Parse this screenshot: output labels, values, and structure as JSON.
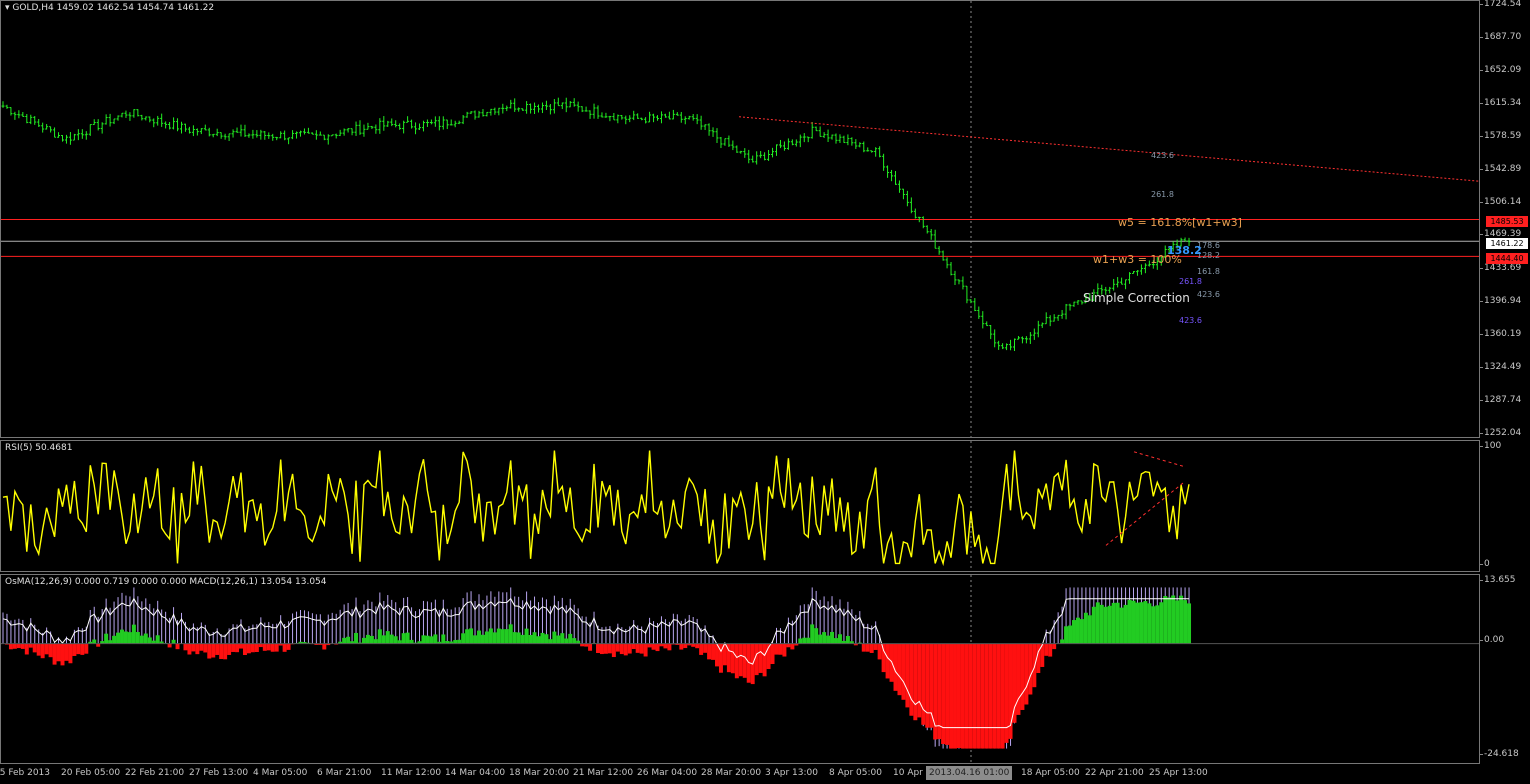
{
  "main_pane": {
    "title": "GOLD,H4  1459.02 1462.54 1454.74 1461.22",
    "price_axis": [
      "1724.54",
      "1687.70",
      "1652.09",
      "1615.34",
      "1578.59",
      "1542.89",
      "1506.14",
      "1469.39",
      "1433.69",
      "1396.94",
      "1360.19",
      "1324.49",
      "1287.74",
      "1252.04"
    ],
    "hlines": [
      {
        "price": 1485.53,
        "color": "#ff2020",
        "label": "1485.53"
      },
      {
        "price": 1461.22,
        "color": "#b0b0b0",
        "label": "1461.22"
      },
      {
        "price": 1444.4,
        "color": "#ff2020",
        "label": "1444.40"
      }
    ],
    "annotations": {
      "w5": "w5 = 161.8%[w1+w3]",
      "w1w3": "w1+w3 = 100%",
      "simple": "Simple Correction",
      "fib_423_top": "423.6",
      "fib_261_top": "261.8",
      "fib_261_low": "261.8",
      "fib_423_low": "423.6",
      "fib_423_bottom": "423.6",
      "fib_161": "161.8",
      "fib_178": "178.6",
      "fib_128": "128.2",
      "fib_1618": "161.8",
      "fib_1381": "138.2"
    }
  },
  "rsi_pane": {
    "title": "RSI(5) 50.4681",
    "scale": [
      "100",
      "0"
    ]
  },
  "osma_pane": {
    "title": "OsMA(12,26,9) 0.000 0.719 0.000 0.000  MACD(12,26,1) 13.054 13.054",
    "scale": [
      "13.655",
      "0.00",
      "-24.618"
    ]
  },
  "time_axis": {
    "labels": [
      "15 Feb 2013",
      "20 Feb 05:00",
      "22 Feb 21:00",
      "27 Feb 13:00",
      "4 Mar 05:00",
      "6 Mar 21:00",
      "11 Mar 12:00",
      "14 Mar 04:00",
      "18 Mar 20:00",
      "21 Mar 12:00",
      "26 Mar 04:00",
      "28 Mar 20:00",
      "3 Apr 13:00",
      "8 Apr 05:00",
      "10 Apr 2",
      "18 Apr 05:00",
      "22 Apr 21:00",
      "25 Apr 13:00"
    ],
    "crosshair": "2013.04.16 01:00"
  },
  "chart_data": {
    "type": "line",
    "symbol": "GOLD",
    "timeframe": "H4",
    "ylim": [
      1252.04,
      1724.54
    ],
    "close_approx": [
      {
        "t": "15 Feb 2013",
        "y": 1612
      },
      {
        "t": "20 Feb 05:00",
        "y": 1575
      },
      {
        "t": "22 Feb 21:00",
        "y": 1605
      },
      {
        "t": "27 Feb 13:00",
        "y": 1585
      },
      {
        "t": "4 Mar 05:00",
        "y": 1580
      },
      {
        "t": "6 Mar 21:00",
        "y": 1578
      },
      {
        "t": "11 Mar 12:00",
        "y": 1590
      },
      {
        "t": "14 Mar 04:00",
        "y": 1592
      },
      {
        "t": "18 Mar 20:00",
        "y": 1612
      },
      {
        "t": "21 Mar 12:00",
        "y": 1613
      },
      {
        "t": "26 Mar 04:00",
        "y": 1598
      },
      {
        "t": "28 Mar 20:00",
        "y": 1598
      },
      {
        "t": "3 Apr 13:00",
        "y": 1550
      },
      {
        "t": "8 Apr 05:00",
        "y": 1585
      },
      {
        "t": "10 Apr",
        "y": 1560
      },
      {
        "t": "12 Apr",
        "y": 1450
      },
      {
        "t": "16 Apr 01:00",
        "y": 1338
      },
      {
        "t": "18 Apr 05:00",
        "y": 1385
      },
      {
        "t": "22 Apr 21:00",
        "y": 1420
      },
      {
        "t": "25 Apr 13:00",
        "y": 1465
      }
    ],
    "trendline": [
      {
        "t": "28 Mar 20:00",
        "y": 1600
      },
      {
        "t": "end",
        "y": 1528
      }
    ],
    "colors": {
      "bars": "#22ee22",
      "rsi": "#ffff00",
      "hline": "#ff2020",
      "macd_up": "#22cc22",
      "macd_down": "#ff1010"
    }
  }
}
